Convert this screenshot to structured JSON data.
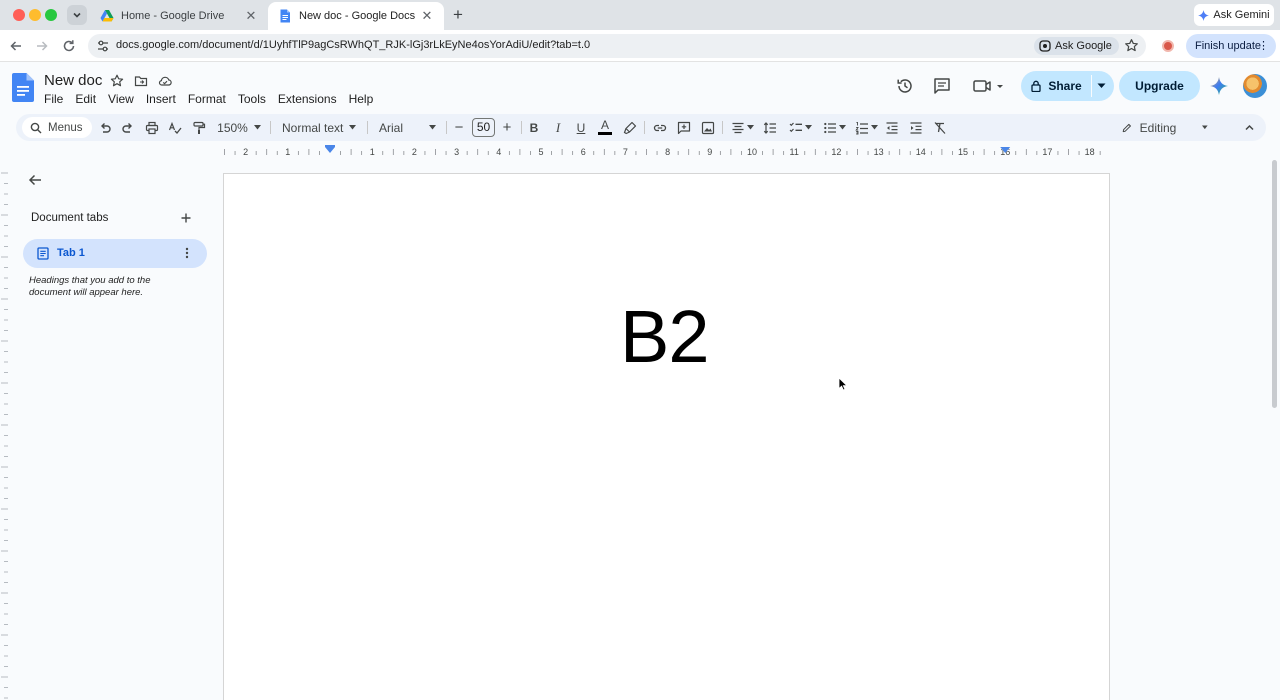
{
  "browser": {
    "tabs": [
      {
        "title": "Home - Google Drive",
        "close": "✕"
      },
      {
        "title": "New doc - Google Docs",
        "close": "✕"
      }
    ],
    "new_tab": "+",
    "ask_gemini": "Ask Gemini",
    "url": "docs.google.com/document/d/1UyhfTlP9agCsRWhQT_RJK-lGj3rLkEyNe4osYorAdiU/edit?tab=t.0",
    "ask_google": "Ask Google",
    "finish_update": "Finish update",
    "kebab": "⋮"
  },
  "docs": {
    "title": "New doc",
    "menu": [
      "File",
      "Edit",
      "View",
      "Insert",
      "Format",
      "Tools",
      "Extensions",
      "Help"
    ],
    "share_label": "Share",
    "upgrade_label": "Upgrade",
    "accent": "#0b57d0"
  },
  "toolbar": {
    "menus_label": "Menus",
    "zoom": "150%",
    "style": "Normal text",
    "font": "Arial",
    "font_size": "50",
    "minus": "−",
    "plus": "+",
    "bold": "B",
    "italic": "I",
    "underline": "U",
    "text_color_letter": "A",
    "mode": "Editing"
  },
  "ruler": {
    "labels": [
      "2",
      "1",
      "1",
      "2",
      "3",
      "4",
      "5",
      "6",
      "7",
      "8",
      "9",
      "10",
      "11",
      "12",
      "13",
      "14",
      "15",
      "16",
      "17",
      "18"
    ]
  },
  "sidebar": {
    "heading": "Document tabs",
    "tab_label": "Tab 1",
    "hint": "Headings that you add to the document will appear here."
  },
  "document": {
    "text": "B2"
  }
}
